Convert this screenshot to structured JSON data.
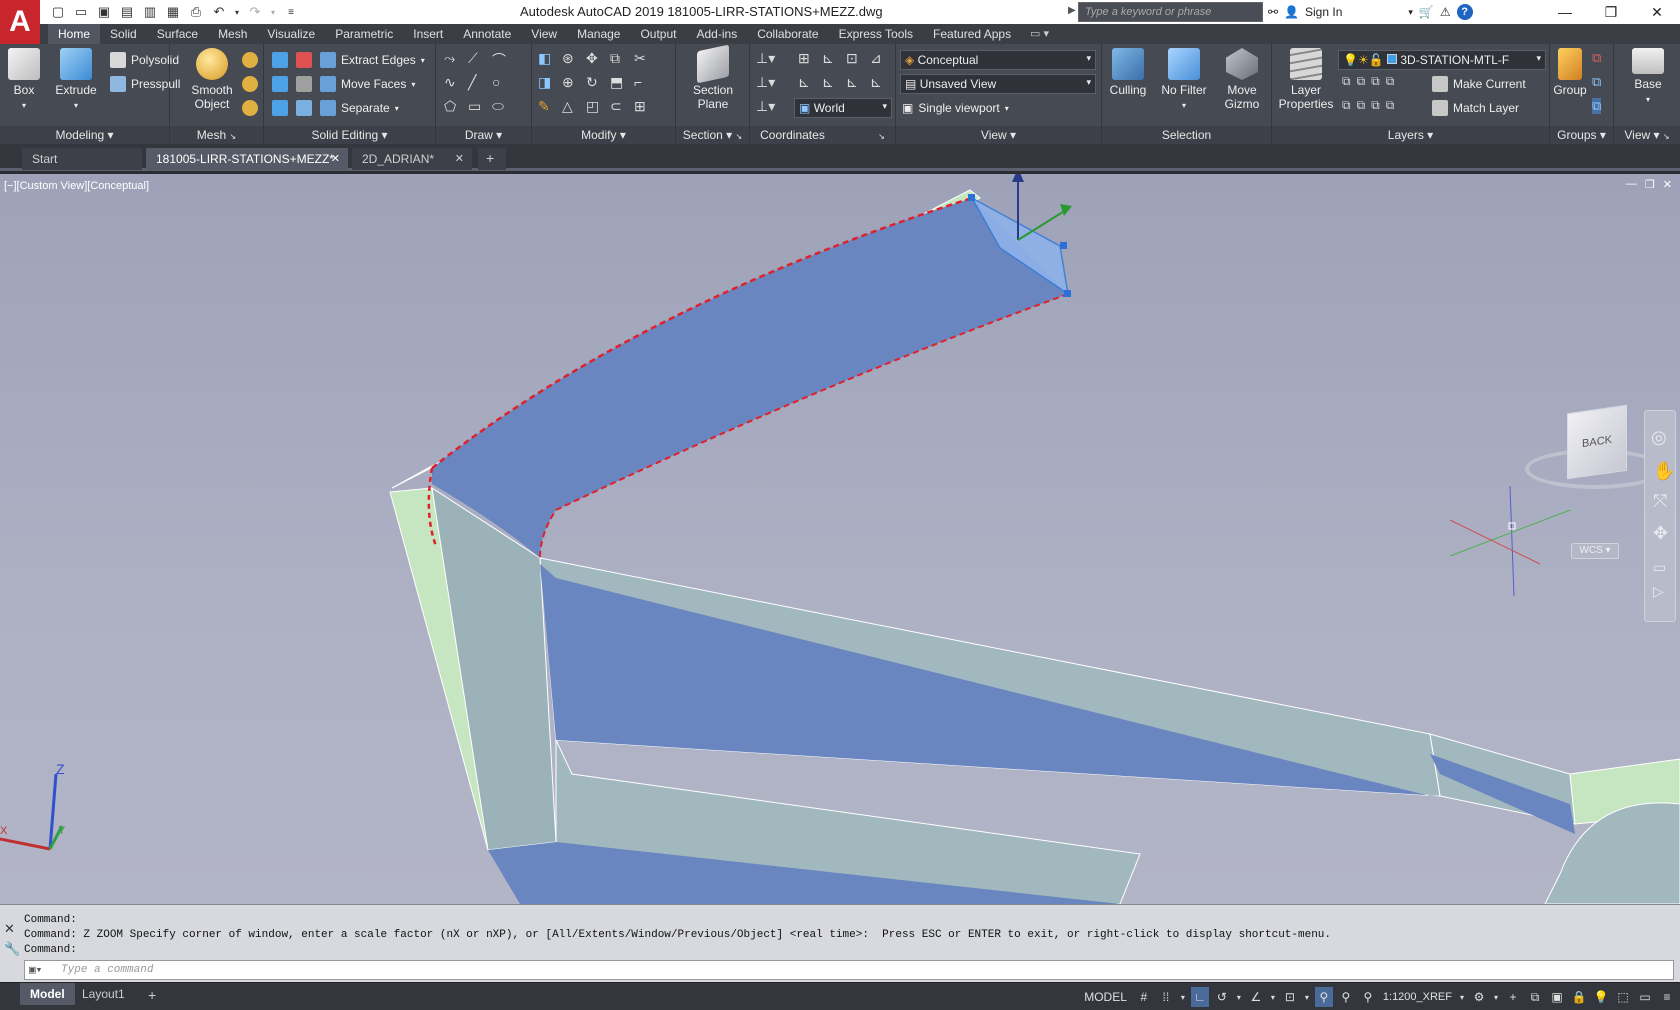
{
  "app": {
    "logo_letter": "A",
    "title": "Autodesk AutoCAD 2019    181005-LIRR-STATIONS+MEZZ.dwg",
    "search_placeholder": "Type a keyword or phrase",
    "sign_in": "Sign In"
  },
  "ribbon_tabs": [
    "Home",
    "Solid",
    "Surface",
    "Mesh",
    "Visualize",
    "Parametric",
    "Insert",
    "Annotate",
    "View",
    "Manage",
    "Output",
    "Add-ins",
    "Collaborate",
    "Express Tools",
    "Featured Apps"
  ],
  "ribbon": {
    "modeling": {
      "title": "Modeling",
      "box": "Box",
      "extrude": "Extrude",
      "polysolid": "Polysolid",
      "presspull": "Presspull"
    },
    "mesh": {
      "title": "Mesh",
      "smooth_line1": "Smooth",
      "smooth_line2": "Object"
    },
    "solid_editing": {
      "title": "Solid Editing",
      "extract_edges": "Extract Edges",
      "move_faces": "Move Faces",
      "separate": "Separate"
    },
    "draw": {
      "title": "Draw"
    },
    "modify": {
      "title": "Modify"
    },
    "section": {
      "title": "Section",
      "plane_line1": "Section",
      "plane_line2": "Plane"
    },
    "coordinates": {
      "title": "Coordinates",
      "world": "World"
    },
    "view": {
      "title": "View",
      "visual_style": "Conceptual",
      "saved_view": "Unsaved View",
      "viewport": "Single viewport"
    },
    "selection": {
      "title": "Selection",
      "culling": "Culling",
      "no_filter": "No Filter",
      "move_line1": "Move",
      "move_line2": "Gizmo"
    },
    "layers": {
      "title": "Layers",
      "props_line1": "Layer",
      "props_line2": "Properties",
      "current_layer": "3D-STATION-MTL-F",
      "make_current": "Make Current",
      "match_layer": "Match Layer"
    },
    "groups": {
      "title": "Groups",
      "group": "Group"
    },
    "viewpanel": {
      "title": "View",
      "base": "Base"
    }
  },
  "doc_tabs": [
    "Start",
    "181005-LIRR-STATIONS+MEZZ*",
    "2D_ADRIAN*"
  ],
  "viewport": {
    "label": "[−][Custom View][Conceptual]",
    "viewcube_face": "BACK",
    "wcs": "WCS",
    "ucs_z": "Z",
    "ucs_y": "Y",
    "ucs_x": "X"
  },
  "command": {
    "line1": "Command:",
    "line2": "Command: Z ZOOM Specify corner of window, enter a scale factor (nX or nXP), or [All/Extents/Window/Previous/Object] <real time>:  Press ESC or ENTER to exit, or right-click to display shortcut-menu.",
    "line3": "Command:",
    "placeholder": "Type a command"
  },
  "status": {
    "model_tab": "Model",
    "layout_tab": "Layout1",
    "model_space": "MODEL",
    "scale": "1:1200_XREF"
  },
  "colors": {
    "accent": "#c9252c",
    "selected_face": "#6a86c0",
    "structure_face": "#9ab2b8",
    "edge_face": "#c6e6c2",
    "highlight_dash": "#e0202a"
  }
}
